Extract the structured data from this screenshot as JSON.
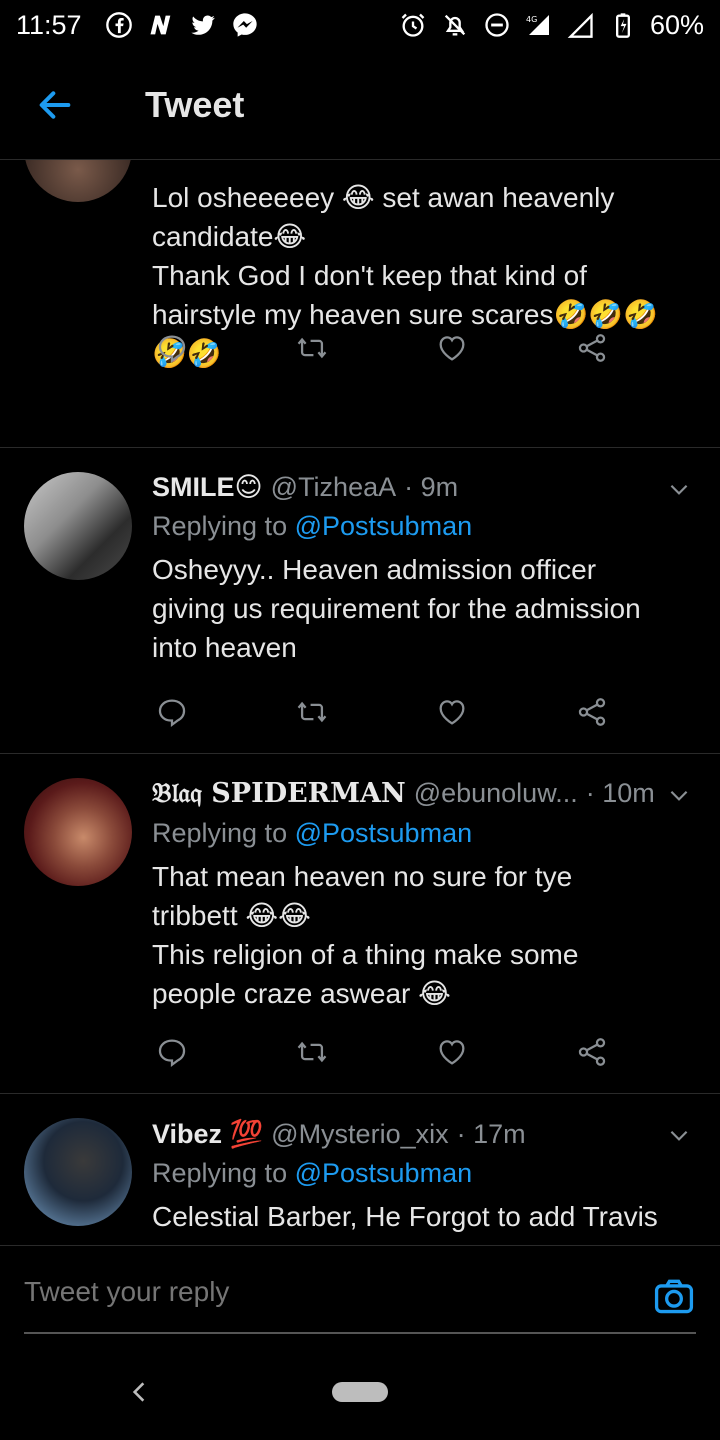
{
  "status_bar": {
    "time": "11:57",
    "battery": "60%",
    "network": "4G"
  },
  "header": {
    "title": "Tweet"
  },
  "tweets": [
    {
      "text_lines": [
        "Lol osheeeeey 😂 set awan heavenly",
        "candidate😂",
        "Thank God I don't keep that kind of",
        "hairstyle my heaven sure scares🤣🤣🤣",
        "🤣🤣"
      ]
    },
    {
      "name": "SMILE😊",
      "handle": "@TizheaA",
      "time": "· 9m",
      "replying_label": "Replying to",
      "replying_to": "@Postsubman",
      "text_lines": [
        "Osheyyy.. Heaven admission officer",
        "giving us requirement for the admission",
        "into heaven"
      ]
    },
    {
      "name": "𝔅𝔩𝔞𝔮 SPIDERMAN",
      "handle": "@ebunoluw...",
      "time": "· 10m",
      "replying_label": "Replying to",
      "replying_to": "@Postsubman",
      "text_lines": [
        "That mean heaven no sure for tye",
        "tribbett 😂😂",
        "This religion of a thing make some",
        "people craze aswear 😂"
      ]
    },
    {
      "name": "Vibez 💯",
      "handle": "@Mysterio_xix",
      "time": "· 17m",
      "replying_label": "Replying to",
      "replying_to": "@Postsubman",
      "text_lines": [
        "Celestial Barber,  He Forgot to add Travis"
      ]
    }
  ],
  "reply_bar": {
    "placeholder": "Tweet your reply"
  },
  "colors": {
    "accent": "#1d9bf0",
    "background": "#000000",
    "muted": "#8a8f94"
  }
}
